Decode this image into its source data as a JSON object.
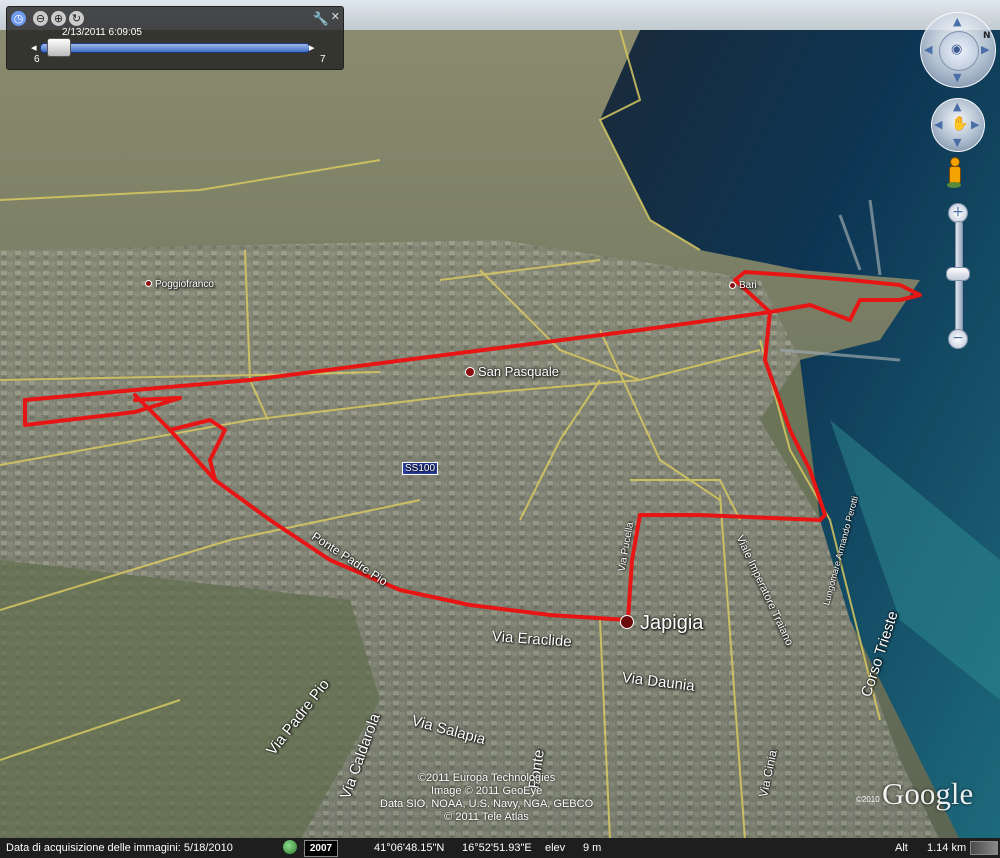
{
  "time_slider": {
    "datetime": "2/13/2011   6:09:05",
    "start_label": "6",
    "end_label": "7"
  },
  "places": {
    "bari": "Bari",
    "poggiofranco": "Poggiofranco",
    "san_pasquale": "San Pasquale",
    "japigia": "Japigia"
  },
  "roads": {
    "ss100": "SS100",
    "ponte_padre_pio": "Ponte Padre Pio",
    "via_eraclide": "Via Eraclide",
    "via_daunia": "Via Daunia",
    "via_padre_pio": "Via Padre Pio",
    "via_caldarola": "Via Caldarola",
    "via_salapia": "Via Salapia",
    "via_pucella": "Via Pucella",
    "viale_imperatore_traiano": "Viale Imperatore Traiano",
    "corso_trieste": "Corso Trieste",
    "via_cinia": "Via Cinia",
    "lungomare": "Lungomare Armando Perotti",
    "ponte": "Ponte"
  },
  "credits": [
    "©2011 Europa Technologies",
    "Image © 2011 GeoEye",
    "Data SIO, NOAA, U.S. Navy, NGA, GEBCO",
    "© 2011 Tele Atlas"
  ],
  "logo": "Google",
  "logo_year": "©2010",
  "status_bar": {
    "acquisition": "Data di acquisizione delle immagini: 5/18/2010",
    "year": "2007",
    "lat": "41°06'48.15\"N",
    "lon": "16°52'51.93\"E",
    "elev_label": "elev",
    "elev_value": "9 m",
    "alt_label": "Alt",
    "alt_value": "1.14 km"
  },
  "colors": {
    "track": "#e81515",
    "road": "#d8c860",
    "sea": "#0e3a5a"
  }
}
